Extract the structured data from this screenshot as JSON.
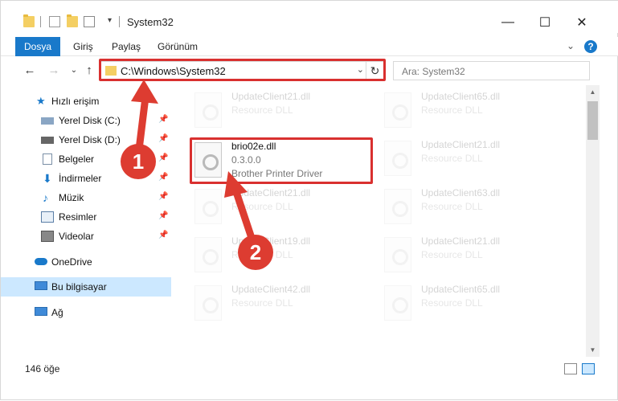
{
  "window": {
    "title": "System32",
    "controls": {
      "minimize": "—",
      "maximize": "☐",
      "close": "✕"
    }
  },
  "ribbon": {
    "tabs": [
      "Dosya",
      "Giriş",
      "Paylaş",
      "Görünüm"
    ],
    "expand": "⌄",
    "help": "?"
  },
  "nav": {
    "back": "←",
    "forward": "→",
    "recent": "⌄",
    "up": "↑",
    "address": "C:\\Windows\\System32",
    "address_drop": "⌄",
    "refresh": "↻",
    "search_placeholder": "Ara: System32"
  },
  "sidebar": {
    "items": [
      {
        "label": "Hızlı erişim",
        "icon": "star-icon",
        "pinned": false
      },
      {
        "label": "Yerel Disk (C:)",
        "icon": "drive-icon",
        "pinned": true
      },
      {
        "label": "Yerel Disk (D:)",
        "icon": "drive-icon",
        "pinned": true
      },
      {
        "label": "Belgeler",
        "icon": "documents-icon",
        "pinned": true
      },
      {
        "label": "İndirmeler",
        "icon": "download-icon",
        "pinned": true
      },
      {
        "label": "Müzik",
        "icon": "music-icon",
        "pinned": true
      },
      {
        "label": "Resimler",
        "icon": "pictures-icon",
        "pinned": true
      },
      {
        "label": "Videolar",
        "icon": "videos-icon",
        "pinned": true
      },
      {
        "label": "OneDrive",
        "icon": "cloud-icon",
        "pinned": false
      },
      {
        "label": "Bu bilgisayar",
        "icon": "computer-icon",
        "pinned": false
      },
      {
        "label": "Ağ",
        "icon": "network-icon",
        "pinned": false
      }
    ],
    "pin_glyph": "📌"
  },
  "files": {
    "highlighted": {
      "name": "brio02e.dll",
      "version": "0.3.0.0",
      "description": "Brother Printer Driver"
    },
    "left_column": [
      {
        "name": "UpdateClient21.dll",
        "type": "Resource DLL"
      },
      {
        "name": "UpdateClient21.dll",
        "type": "Resource DLL"
      },
      {
        "name": "UpdateClient19.dll",
        "type": "Resource DLL"
      },
      {
        "name": "UpdateClient42.dll",
        "type": "Resource DLL"
      }
    ],
    "right_column": [
      {
        "name": "UpdateClient65.dll",
        "type": "Resource DLL"
      },
      {
        "name": "UpdateClient21.dll",
        "type": "Resource DLL"
      },
      {
        "name": "UpdateClient63.dll",
        "type": "Resource DLL"
      },
      {
        "name": "UpdateClient21.dll",
        "type": "Resource DLL"
      },
      {
        "name": "UpdateClient65.dll",
        "type": "Resource DLL"
      }
    ]
  },
  "status": {
    "count": "146 öğe"
  },
  "callouts": {
    "one": "1",
    "two": "2"
  },
  "colors": {
    "accent": "#1979ca",
    "highlight": "#d9302f",
    "selected": "#cce8ff"
  }
}
